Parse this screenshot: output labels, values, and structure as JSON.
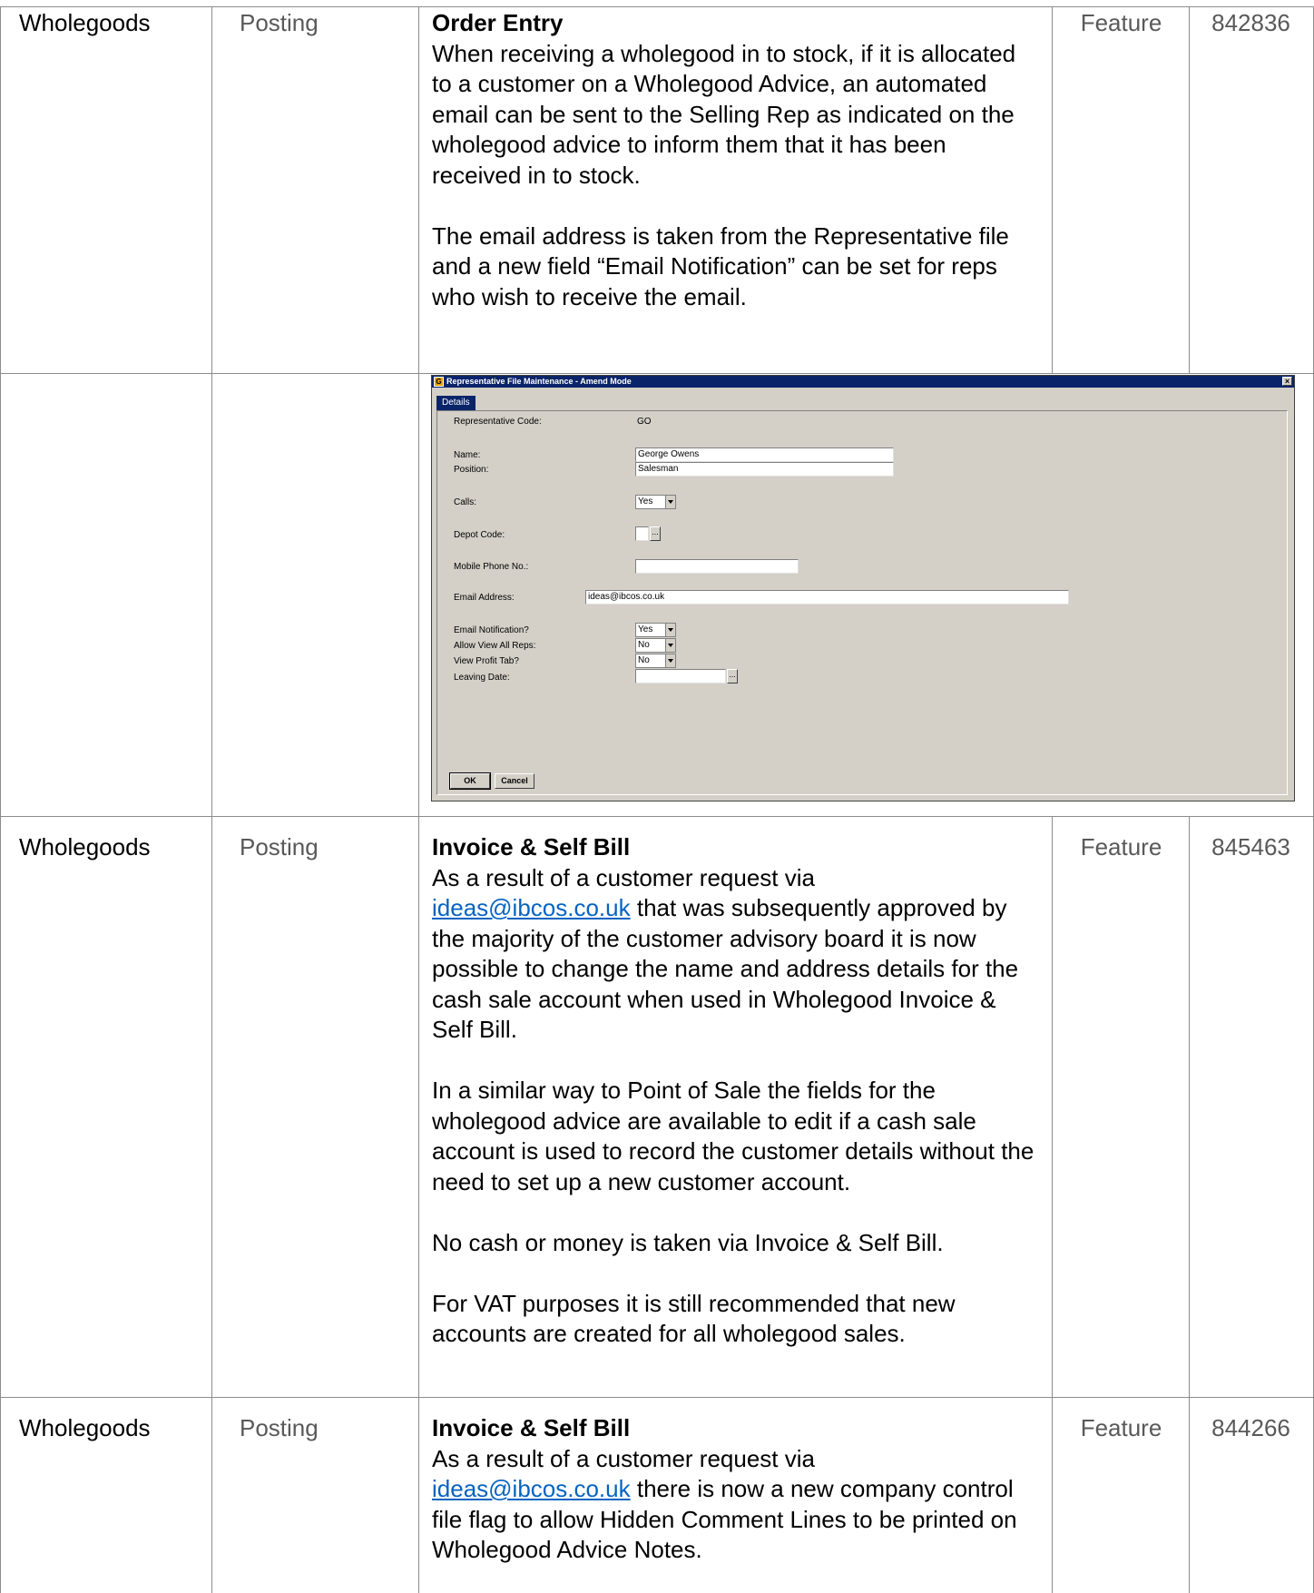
{
  "rows": [
    {
      "module": "Wholegoods",
      "area": "Posting",
      "heading": "Order Entry",
      "paragraphs": [
        "When receiving a wholegood in to stock, if it is allocated to a customer on a Wholegood Advice, an automated email can be sent to the Selling Rep as indicated on the wholegood advice to inform them that it has been received in to stock.",
        "The email address is taken from the Representative file and a new field “Email Notification” can be set for reps who wish to receive the email."
      ],
      "type": "Feature",
      "ref": "842836"
    },
    {
      "module": "Wholegoods",
      "area": "Posting",
      "heading": "Invoice & Self Bill",
      "intro_before_link": "As a result of a customer request via",
      "link": "ideas@ibcos.co.uk",
      "intro_after_link": "that was subsequently approved by the majority of the customer advisory board it is now possible to change the name and address details for the cash sale account when used in Wholegood Invoice & Self Bill.",
      "paragraphs": [
        "In a similar way to Point of Sale the fields for the wholegood advice are available to edit if a cash sale account is used to record the customer details without the need to set up a new customer account.",
        "No cash or money is taken via Invoice & Self Bill.",
        "For VAT purposes it is still recommended that new accounts are created for all wholegood sales."
      ],
      "type": "Feature",
      "ref": "845463"
    },
    {
      "module": "Wholegoods",
      "area": "Posting",
      "heading": "Invoice & Self Bill",
      "intro_before_link": "As a result of a customer request via",
      "link": "ideas@ibcos.co.uk",
      "intro_after_link": "there is now a new company control file flag to allow Hidden Comment Lines to be printed on Wholegood Advice Notes.",
      "type": "Feature",
      "ref": "844266"
    }
  ],
  "dialog": {
    "title": "Representative File Maintenance - Amend Mode",
    "app_icon": "app-icon",
    "close_icon": "close-icon",
    "tab": "Details",
    "rep_code_label": "Representative Code:",
    "rep_code_value": "GO",
    "name_label": "Name:",
    "name_value": "George Owens",
    "position_label": "Position:",
    "position_value": "Salesman",
    "calls_label": "Calls:",
    "calls_value": "Yes",
    "depot_label": "Depot Code:",
    "depot_value": "",
    "lookup_glyph": "...",
    "mobile_label": "Mobile Phone No.:",
    "mobile_value": "",
    "email_label": "Email Address:",
    "email_value": "ideas@ibcos.co.uk",
    "email_notif_label": "Email Notification?",
    "email_notif_value": "Yes",
    "view_all_label": "Allow View All Reps:",
    "view_all_value": "No",
    "view_profit_label": "View Profit Tab?",
    "view_profit_value": "No",
    "leaving_label": "Leaving Date:",
    "leaving_value": "",
    "ok_label": "OK",
    "cancel_label": "Cancel"
  }
}
